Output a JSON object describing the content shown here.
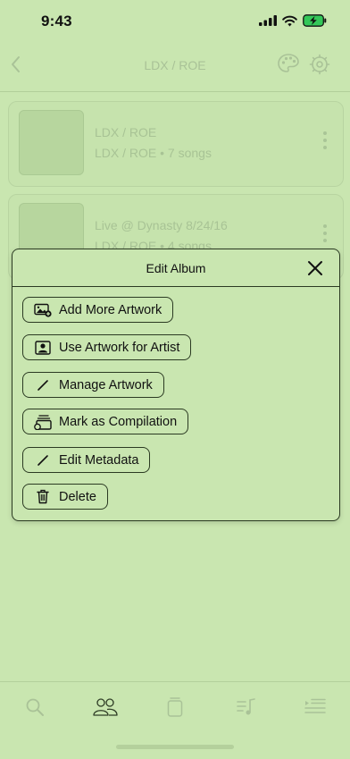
{
  "status": {
    "time": "9:43"
  },
  "nav": {
    "title": "LDX / ROE"
  },
  "albums": [
    {
      "title": "LDX / ROE",
      "subtitle": "LDX / ROE • 7 songs"
    },
    {
      "title": "Live @ Dynasty 8/24/16",
      "subtitle": "LDX / ROE • 4 songs"
    }
  ],
  "modal": {
    "title": "Edit Album",
    "actions": [
      {
        "label": "Add More Artwork",
        "icon": "image-add-icon"
      },
      {
        "label": "Use Artwork for Artist",
        "icon": "person-portrait-icon"
      },
      {
        "label": "Manage Artwork",
        "icon": "pencil-icon"
      },
      {
        "label": "Mark as Compilation",
        "icon": "compilation-icon"
      },
      {
        "label": "Edit Metadata",
        "icon": "pencil-icon"
      },
      {
        "label": "Delete",
        "icon": "trash-icon"
      }
    ]
  },
  "tabs": [
    "search-tab",
    "artists-tab",
    "albums-tab",
    "songs-tab",
    "queue-tab"
  ],
  "colors": {
    "background": "#c9e6b0",
    "outline": "#2b3a22",
    "faded": "#a8c395"
  }
}
